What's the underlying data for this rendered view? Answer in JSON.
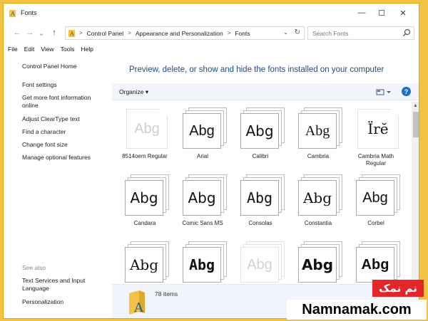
{
  "window": {
    "title": "Fonts",
    "controls": {
      "minimize": "—",
      "maximize": "☐",
      "close": "✕"
    }
  },
  "nav": {
    "back": "←",
    "forward": "→",
    "recent": "⌄",
    "up": "↑"
  },
  "address": {
    "breadcrumbs": [
      "Control Panel",
      "Appearance and Personalization",
      "Fonts"
    ],
    "separator": ">",
    "dropdown": "⌄",
    "refresh": "↻"
  },
  "search": {
    "placeholder": "Search Fonts"
  },
  "menu": [
    "File",
    "Edit",
    "View",
    "Tools",
    "Help"
  ],
  "sidebar": {
    "home": "Control Panel Home",
    "links": [
      "Font settings",
      "Get more font information online",
      "Adjust ClearType text",
      "Find a character",
      "Change font size",
      "Manage optional features"
    ],
    "see_also_heading": "See also",
    "see_also": [
      "Text Services and Input Language",
      "Personalization"
    ]
  },
  "content": {
    "title": "Preview, delete, or show and hide the fonts installed on your computer",
    "organize": "Organize ▾",
    "help": "?"
  },
  "fonts": [
    {
      "name": "8514oem Regular",
      "sample": "Abg",
      "style": "single"
    },
    {
      "name": "Arial",
      "sample": "Abg",
      "style": "stack"
    },
    {
      "name": "Calibri",
      "sample": "Abg",
      "style": "stack"
    },
    {
      "name": "Cambria",
      "sample": "Abg",
      "style": "stack"
    },
    {
      "name": "Cambria Math Regular",
      "sample": "Ïrĕ",
      "style": "single"
    },
    {
      "name": "Candara",
      "sample": "Abg",
      "style": "stack"
    },
    {
      "name": "Comic Sans MS",
      "sample": "Abg",
      "style": "stack"
    },
    {
      "name": "Consolas",
      "sample": "Abg",
      "style": "stack"
    },
    {
      "name": "Constantia",
      "sample": "Abg",
      "style": "stack"
    },
    {
      "name": "Corbel",
      "sample": "Abg",
      "style": "stack"
    },
    {
      "name": "",
      "sample": "Abg",
      "style": "stack"
    },
    {
      "name": "",
      "sample": "Abg",
      "style": "stack"
    },
    {
      "name": "",
      "sample": "Abg",
      "style": "faded"
    },
    {
      "name": "",
      "sample": "Abg",
      "style": "stack"
    },
    {
      "name": "",
      "sample": "Abg",
      "style": "stack"
    }
  ],
  "details": {
    "count": "78 items"
  },
  "watermark": {
    "brand_fa": "نم نمک",
    "site": "Namnamak.com"
  },
  "colors": {
    "accent": "#f3c244",
    "title_blue": "#1f4a85",
    "pane_bg": "#f1f5fb",
    "watermark_red": "#e4262b"
  }
}
